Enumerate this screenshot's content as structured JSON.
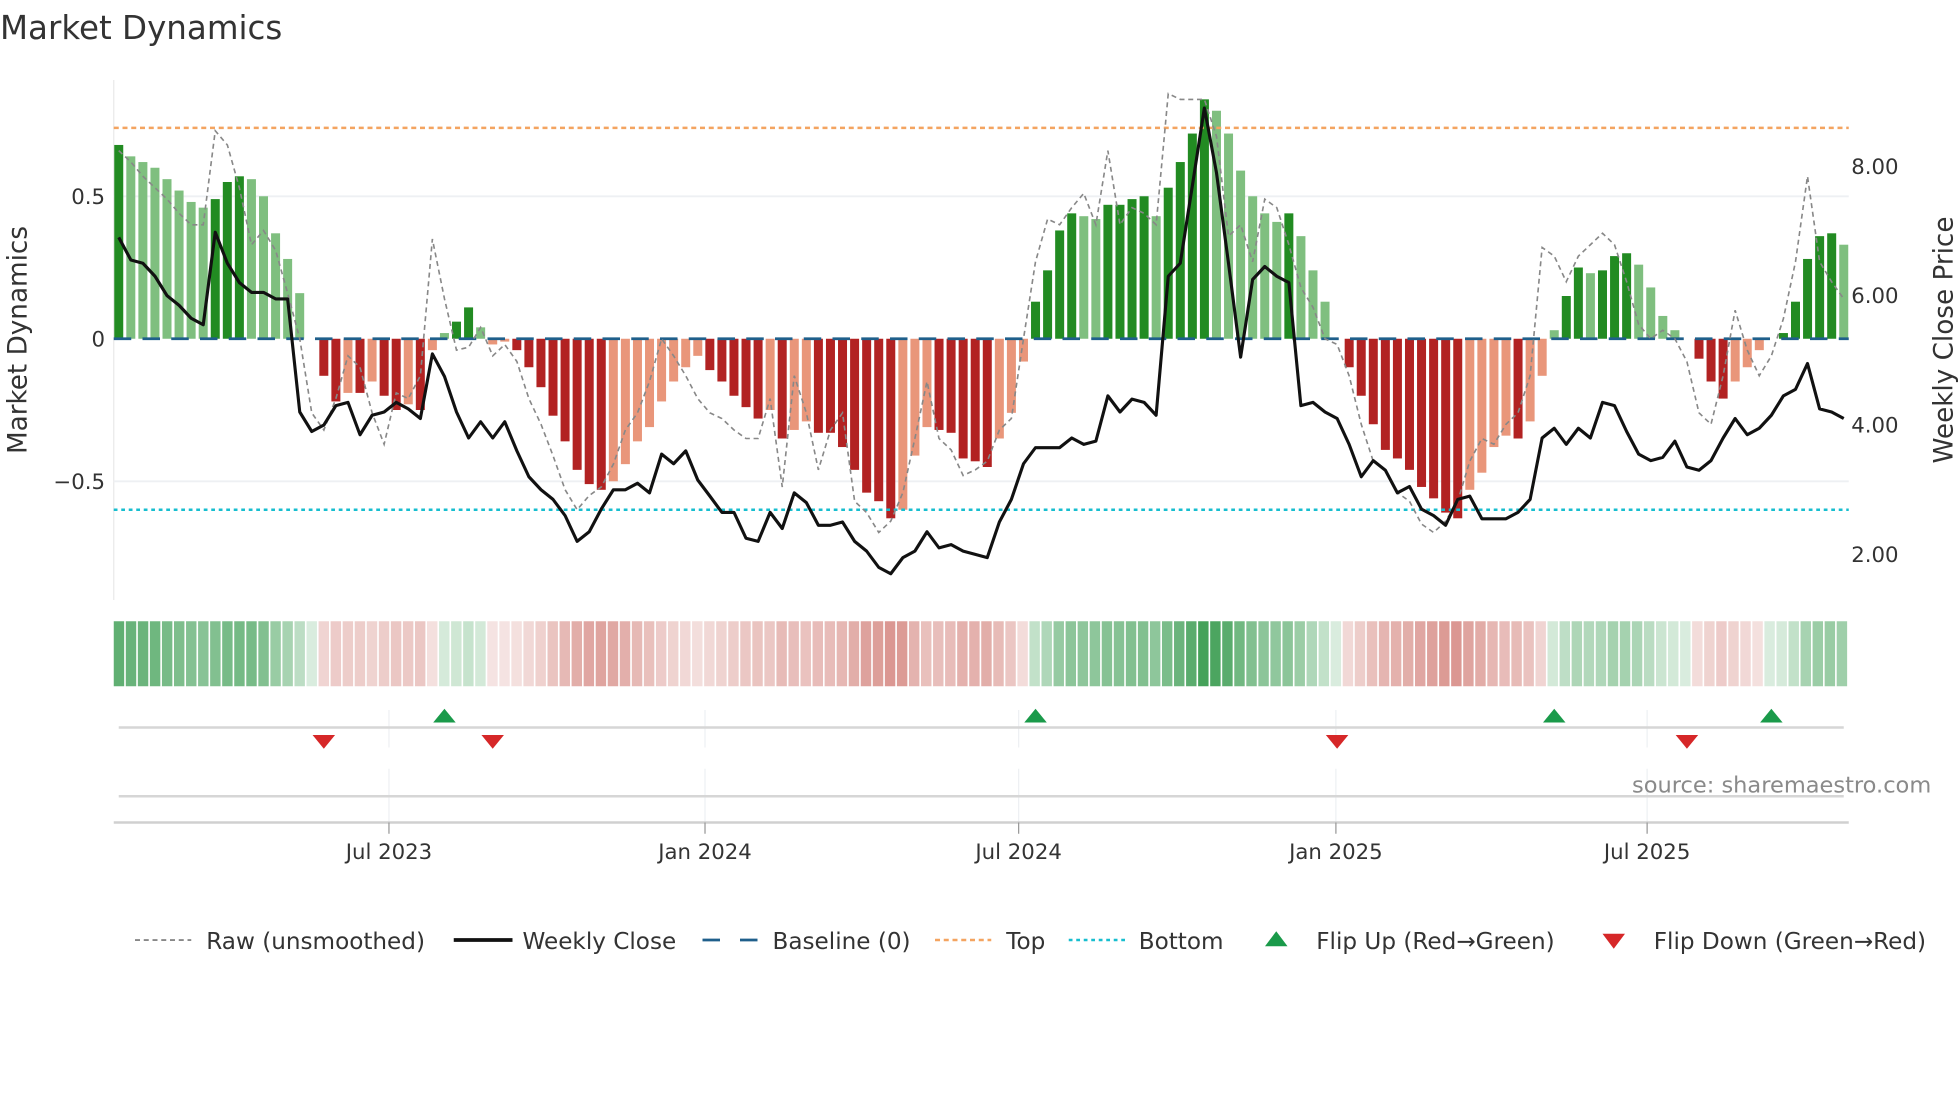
{
  "title": "Market Dynamics",
  "source": "source: sharemaestro.com",
  "colors": {
    "green_dark": "#228b22",
    "green_light": "#7fbf7f",
    "red_dark": "#b22222",
    "red_light": "#e9967a",
    "baseline": "#1f5f8b",
    "top": "#f4a460",
    "bottom": "#17becf",
    "close": "#111111",
    "raw": "#888888",
    "flip_up": "#1a9a4a",
    "flip_down": "#d62728"
  },
  "chart_data": {
    "type": "bar",
    "title": "Market Dynamics",
    "ylabel": "Market Dynamics",
    "y2label": "Weekly Close Price",
    "ylim": [
      -0.92,
      0.9
    ],
    "y2lim": [
      1.2,
      9.3
    ],
    "yticks": [
      {
        "v": 0.5,
        "label": "0.5"
      },
      {
        "v": 0,
        "label": "0"
      },
      {
        "v": -0.5,
        "label": "−0.5"
      }
    ],
    "y2ticks": [
      {
        "v": 8,
        "label": "8.00"
      },
      {
        "v": 6,
        "label": "6.00"
      },
      {
        "v": 4,
        "label": "4.00"
      },
      {
        "v": 2,
        "label": "2.00"
      }
    ],
    "xticks": [
      {
        "i": 22.4,
        "label": "Jul 2023"
      },
      {
        "i": 48.6,
        "label": "Jan 2024"
      },
      {
        "i": 74.6,
        "label": "Jul 2024"
      },
      {
        "i": 100.9,
        "label": "Jan 2025"
      },
      {
        "i": 126.7,
        "label": "Jul 2025"
      }
    ],
    "top_level": 0.74,
    "bottom_level": -0.6,
    "baseline": 0,
    "histogram": [
      0.68,
      0.64,
      0.62,
      0.6,
      0.56,
      0.52,
      0.48,
      0.46,
      0.49,
      0.55,
      0.57,
      0.56,
      0.5,
      0.37,
      0.28,
      0.16,
      0,
      -0.13,
      -0.22,
      -0.19,
      -0.19,
      -0.15,
      -0.2,
      -0.25,
      -0.23,
      -0.25,
      -0.04,
      0.02,
      0.06,
      0.11,
      0.04,
      -0.02,
      -0.01,
      -0.04,
      -0.1,
      -0.17,
      -0.27,
      -0.36,
      -0.46,
      -0.51,
      -0.53,
      -0.5,
      -0.44,
      -0.36,
      -0.31,
      -0.22,
      -0.15,
      -0.1,
      -0.06,
      -0.11,
      -0.15,
      -0.2,
      -0.24,
      -0.28,
      -0.25,
      -0.35,
      -0.32,
      -0.29,
      -0.33,
      -0.33,
      -0.38,
      -0.46,
      -0.54,
      -0.57,
      -0.63,
      -0.6,
      -0.41,
      -0.31,
      -0.32,
      -0.33,
      -0.42,
      -0.43,
      -0.45,
      -0.35,
      -0.26,
      -0.08,
      0.13,
      0.24,
      0.38,
      0.44,
      0.43,
      0.42,
      0.47,
      0.47,
      0.49,
      0.5,
      0.43,
      0.53,
      0.62,
      0.72,
      0.84,
      0.8,
      0.72,
      0.59,
      0.5,
      0.44,
      0.41,
      0.44,
      0.36,
      0.24,
      0.13,
      0,
      -0.1,
      -0.2,
      -0.3,
      -0.39,
      -0.42,
      -0.46,
      -0.52,
      -0.56,
      -0.61,
      -0.63,
      -0.53,
      -0.47,
      -0.38,
      -0.34,
      -0.35,
      -0.29,
      -0.13,
      0.03,
      0.15,
      0.25,
      0.23,
      0.24,
      0.29,
      0.3,
      0.26,
      0.18,
      0.08,
      0.03,
      0,
      -0.07,
      -0.15,
      -0.21,
      -0.15,
      -0.1,
      -0.04,
      0,
      0.02,
      0.13,
      0.28,
      0.36,
      0.37,
      0.33
    ],
    "raw": [
      0.66,
      0.62,
      0.57,
      0.53,
      0.49,
      0.44,
      0.4,
      0.4,
      0.73,
      0.68,
      0.53,
      0.33,
      0.38,
      0.31,
      0.16,
      0,
      -0.26,
      -0.32,
      -0.21,
      -0.06,
      -0.1,
      -0.26,
      -0.37,
      -0.19,
      -0.21,
      -0.13,
      0.35,
      0.14,
      -0.04,
      -0.03,
      0.04,
      -0.06,
      -0.02,
      -0.08,
      -0.21,
      -0.3,
      -0.41,
      -0.53,
      -0.6,
      -0.55,
      -0.52,
      -0.44,
      -0.32,
      -0.26,
      -0.15,
      0,
      -0.06,
      -0.13,
      -0.21,
      -0.26,
      -0.28,
      -0.32,
      -0.35,
      -0.35,
      -0.21,
      -0.52,
      -0.13,
      -0.26,
      -0.46,
      -0.32,
      -0.26,
      -0.57,
      -0.61,
      -0.68,
      -0.64,
      -0.54,
      -0.35,
      -0.15,
      -0.35,
      -0.39,
      -0.48,
      -0.46,
      -0.43,
      -0.32,
      -0.28,
      0,
      0.27,
      0.42,
      0.4,
      0.46,
      0.51,
      0.4,
      0.66,
      0.4,
      0.46,
      0.44,
      0.4,
      0.86,
      0.84,
      0.84,
      0.84,
      0.71,
      0.36,
      0.4,
      0.27,
      0.49,
      0.46,
      0.33,
      0.18,
      0.11,
      0,
      -0.02,
      -0.13,
      -0.3,
      -0.43,
      -0.46,
      -0.54,
      -0.57,
      -0.65,
      -0.68,
      -0.64,
      -0.57,
      -0.43,
      -0.35,
      -0.37,
      -0.3,
      -0.26,
      -0.13,
      0.32,
      0.29,
      0.2,
      0.29,
      0.33,
      0.37,
      0.33,
      0.2,
      0.05,
      0,
      0.03,
      0,
      -0.08,
      -0.26,
      -0.3,
      -0.13,
      0.1,
      -0.04,
      -0.13,
      -0.06,
      0.07,
      0.27,
      0.57,
      0.27,
      0.2,
      0.14
    ],
    "weekly_close": [
      6.9,
      6.55,
      6.5,
      6.3,
      6.0,
      5.85,
      5.65,
      5.55,
      6.98,
      6.5,
      6.2,
      6.05,
      6.05,
      5.95,
      5.95,
      4.2,
      3.9,
      4.0,
      4.3,
      4.35,
      3.85,
      4.15,
      4.2,
      4.35,
      4.25,
      4.1,
      5.1,
      4.75,
      4.2,
      3.8,
      4.05,
      3.8,
      4.05,
      3.6,
      3.2,
      3.0,
      2.85,
      2.6,
      2.2,
      2.35,
      2.7,
      3.0,
      3.0,
      3.1,
      2.95,
      3.55,
      3.4,
      3.6,
      3.15,
      2.9,
      2.65,
      2.65,
      2.25,
      2.2,
      2.65,
      2.4,
      2.95,
      2.8,
      2.45,
      2.45,
      2.5,
      2.2,
      2.05,
      1.8,
      1.7,
      1.95,
      2.05,
      2.35,
      2.1,
      2.15,
      2.05,
      2.0,
      1.95,
      2.5,
      2.85,
      3.4,
      3.65,
      3.65,
      3.65,
      3.8,
      3.7,
      3.75,
      4.45,
      4.2,
      4.4,
      4.35,
      4.15,
      6.3,
      6.5,
      7.7,
      8.9,
      7.9,
      6.5,
      5.05,
      6.25,
      6.45,
      6.3,
      6.2,
      4.3,
      4.35,
      4.2,
      4.1,
      3.7,
      3.2,
      3.45,
      3.3,
      2.95,
      3.05,
      2.7,
      2.6,
      2.45,
      2.85,
      2.9,
      2.55,
      2.55,
      2.55,
      2.65,
      2.85,
      3.8,
      3.95,
      3.7,
      3.95,
      3.8,
      4.35,
      4.3,
      3.9,
      3.55,
      3.45,
      3.5,
      3.75,
      3.35,
      3.3,
      3.45,
      3.8,
      4.1,
      3.85,
      3.95,
      4.15,
      4.45,
      4.55,
      4.95,
      4.25,
      4.2,
      4.1
    ],
    "flip_up_indices": [
      27,
      76,
      119,
      137
    ],
    "flip_down_indices": [
      17,
      31,
      101,
      130
    ],
    "legend": [
      {
        "label": "Raw (unsmoothed)",
        "style": "raw"
      },
      {
        "label": "Weekly Close",
        "style": "close"
      },
      {
        "label": "Baseline (0)",
        "style": "baseline"
      },
      {
        "label": "Top",
        "style": "top"
      },
      {
        "label": "Bottom",
        "style": "bottom"
      },
      {
        "label": "Flip Up (Red→Green)",
        "style": "up"
      },
      {
        "label": "Flip Down (Green→Red)",
        "style": "down"
      }
    ],
    "legend_position": "bottom"
  }
}
